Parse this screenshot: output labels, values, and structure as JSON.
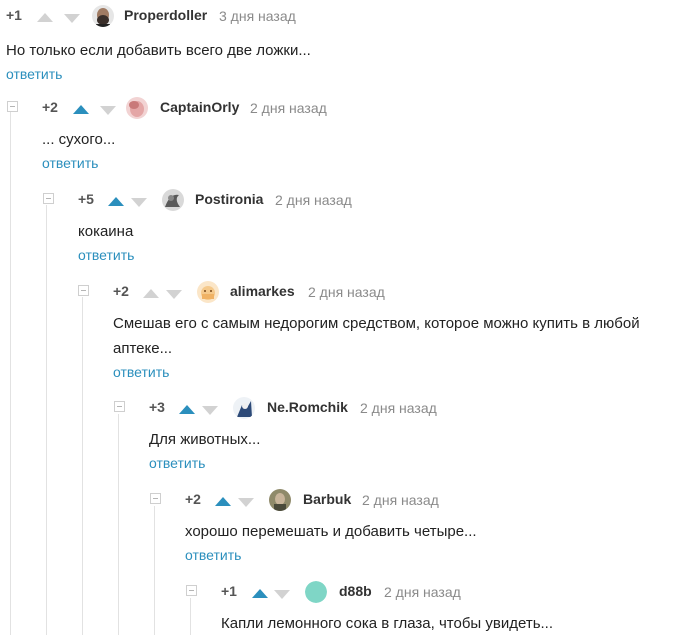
{
  "reply_label": "ответить",
  "colors": {
    "accent": "#2b8fbd",
    "vote_inactive": "#d2d2d2"
  },
  "comments": [
    {
      "rating": "+1",
      "user": "Properdoller",
      "time": "3 дня назад",
      "text": "Но только если добавить всего две ложки...",
      "avatar_icon": "bearded-man-avatar",
      "vote_up_active": false
    },
    {
      "rating": "+2",
      "user": "CaptainOrly",
      "time": "2 дня назад",
      "text": "... сухого...",
      "avatar_icon": "pink-face-avatar",
      "vote_up_active": true
    },
    {
      "rating": "+5",
      "user": "Postironia",
      "time": "2 дня назад",
      "text": "кокаина",
      "avatar_icon": "gray-figure-avatar",
      "vote_up_active": true
    },
    {
      "rating": "+2",
      "user": "alimarkes",
      "time": "2 дня назад",
      "text": "Смешав его с самым недорогим средством, которое можно купить в любой аптеке...",
      "avatar_icon": "cartoon-avatar",
      "vote_up_active": false
    },
    {
      "rating": "+3",
      "user": "Ne.Romchik",
      "time": "2 дня назад",
      "text": "Для животных...",
      "avatar_icon": "blue-figure-avatar",
      "vote_up_active": true
    },
    {
      "rating": "+2",
      "user": "Barbuk",
      "time": "2 дня назад",
      "text": "хорошо перемешать и добавить четыре...",
      "avatar_icon": "man-portrait-avatar",
      "vote_up_active": true
    },
    {
      "rating": "+1",
      "user": "d88b",
      "time": "2 дня назад",
      "text": "Капли лемонного сока в глаза, чтобы увидеть...",
      "avatar_icon": "teal-circle-avatar",
      "vote_up_active": true
    }
  ]
}
